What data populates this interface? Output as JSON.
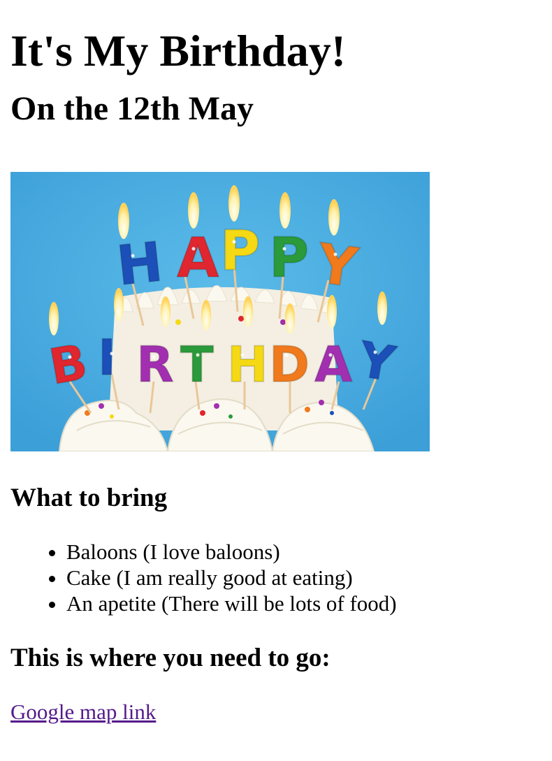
{
  "page": {
    "title": "It's My Birthday!",
    "date_heading": "On the 12th May",
    "image": {
      "letters_happy": [
        "H",
        "A",
        "P",
        "P",
        "Y"
      ],
      "letters_birthday": [
        "B",
        "I",
        "R",
        "T",
        "H",
        "D",
        "A",
        "Y"
      ],
      "colors": {
        "sky": "#48ace0",
        "red": "#e0262e",
        "blue": "#1c4fb8",
        "yellow": "#f5d914",
        "green": "#2a9a3a",
        "orange": "#f07a1c",
        "purple": "#a22fb0",
        "frosting": "#f6f2e6"
      }
    },
    "bring_heading": "What to bring",
    "bring_items": [
      "Baloons (I love baloons)",
      "Cake (I am really good at eating)",
      "An apetite (There will be lots of food)"
    ],
    "where_heading": "This is where you need to go:",
    "map_link_label": "Google map link"
  }
}
